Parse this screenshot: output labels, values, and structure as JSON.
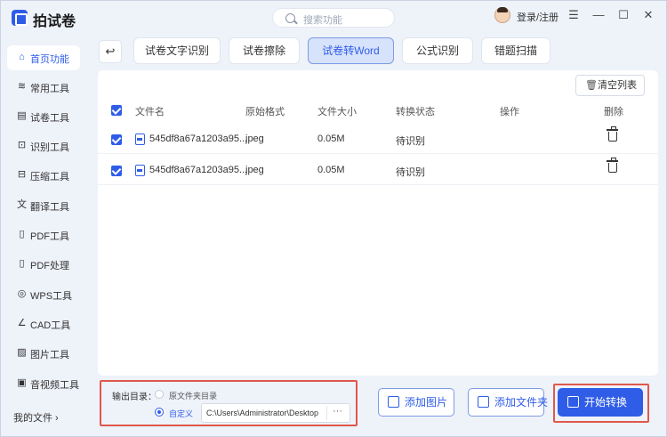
{
  "app": {
    "title": "拍试卷"
  },
  "search": {
    "placeholder": "搜索功能"
  },
  "account": {
    "login_label": "登录/注册"
  },
  "window_controls": {
    "menu": "☰",
    "minimize": "—",
    "maximize": "☐",
    "close": "✕"
  },
  "sidebar": {
    "items": [
      {
        "label": "首页功能",
        "icon": "home-icon",
        "glyph": "⌂",
        "active": true
      },
      {
        "label": "常用工具",
        "icon": "layers-icon",
        "glyph": "≋",
        "active": false
      },
      {
        "label": "试卷工具",
        "icon": "document-icon",
        "glyph": "▤",
        "active": false
      },
      {
        "label": "识别工具",
        "icon": "scan-icon",
        "glyph": "⊡",
        "active": false
      },
      {
        "label": "压缩工具",
        "icon": "compress-icon",
        "glyph": "⊟",
        "active": false
      },
      {
        "label": "翻译工具",
        "icon": "translate-icon",
        "glyph": "文",
        "active": false
      },
      {
        "label": "PDF工具",
        "icon": "pdf-icon",
        "glyph": "▯",
        "active": false
      },
      {
        "label": "PDF处理",
        "icon": "pdf-process-icon",
        "glyph": "▯",
        "active": false
      },
      {
        "label": "WPS工具",
        "icon": "wps-icon",
        "glyph": "◎",
        "active": false
      },
      {
        "label": "CAD工具",
        "icon": "cad-icon",
        "glyph": "∠",
        "active": false
      },
      {
        "label": "图片工具",
        "icon": "image-icon",
        "glyph": "▨",
        "active": false
      },
      {
        "label": "音视频工具",
        "icon": "media-icon",
        "glyph": "▣",
        "active": false
      }
    ],
    "my_files": "我的文件 ›"
  },
  "tabs": [
    {
      "label": "试卷文字识别",
      "active": false
    },
    {
      "label": "试卷擦除",
      "active": false
    },
    {
      "label": "试卷转Word",
      "active": true
    },
    {
      "label": "公式识别",
      "active": false
    },
    {
      "label": "错题扫描",
      "active": false
    }
  ],
  "toolbar": {
    "back_glyph": "↩",
    "clear_label": "清空列表"
  },
  "table": {
    "headers": {
      "name": "文件名",
      "format": "原始格式",
      "size": "文件大小",
      "status": "转换状态",
      "action": "操作",
      "delete": "删除"
    },
    "rows": [
      {
        "name": "545df8a67a1203a95...",
        "format": "jpeg",
        "size": "0.05M",
        "status": "待识别",
        "checked": true
      },
      {
        "name": "545df8a67a1203a95...",
        "format": "jpeg",
        "size": "0.05M",
        "status": "待识别",
        "checked": true
      }
    ]
  },
  "output": {
    "label": "输出目录：",
    "option_source": "原文件夹目录",
    "option_custom": "自定义",
    "selected": "custom",
    "path": "C:\\Users\\Administrator\\Desktop",
    "browse": "···"
  },
  "buttons": {
    "add_image": "添加图片",
    "add_folder": "添加文件夹",
    "start": "开始转换"
  },
  "colors": {
    "accent": "#2f5de8",
    "highlight_border": "#e0584c",
    "background": "#eef2f9"
  }
}
